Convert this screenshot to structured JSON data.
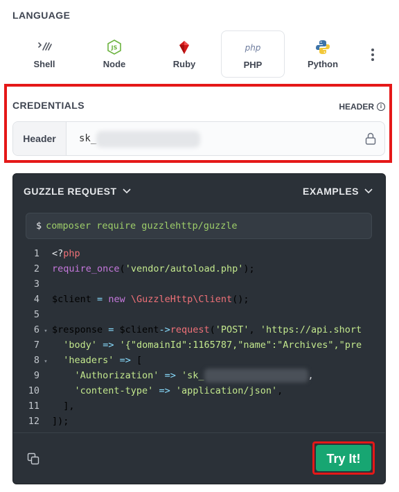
{
  "language": {
    "label": "LANGUAGE",
    "items": [
      {
        "label": "Shell",
        "icon": "shell-icon"
      },
      {
        "label": "Node",
        "icon": "node-icon"
      },
      {
        "label": "Ruby",
        "icon": "ruby-icon"
      },
      {
        "label": "PHP",
        "icon": "php-icon",
        "active": true
      },
      {
        "label": "Python",
        "icon": "python-icon"
      }
    ],
    "php_logo_text": "php"
  },
  "credentials": {
    "label": "CREDENTIALS",
    "location_label": "HEADER",
    "key_label": "Header",
    "value_prefix": "sk_"
  },
  "panel": {
    "request_label": "GUZZLE REQUEST",
    "examples_label": "EXAMPLES",
    "command": "composer require guzzlehttp/guzzle",
    "code_lines": [
      {
        "n": "1",
        "text": "<?php"
      },
      {
        "n": "2",
        "text": "require_once('vendor/autoload.php');"
      },
      {
        "n": "3",
        "text": ""
      },
      {
        "n": "4",
        "text": "$client = new \\GuzzleHttp\\Client();"
      },
      {
        "n": "5",
        "text": ""
      },
      {
        "n": "6",
        "text": "$response = $client->request('POST', 'https://api.short"
      },
      {
        "n": "7",
        "text": "  'body' => '{\"domainId\":1165787,\"name\":\"Archives\",\"pre"
      },
      {
        "n": "8",
        "text": "  'headers' => ["
      },
      {
        "n": "9",
        "text": "    'Authorization' => 'sk_"
      },
      {
        "n": "10",
        "text": "    'content-type' => 'application/json',"
      },
      {
        "n": "11",
        "text": "  ],"
      },
      {
        "n": "12",
        "text": "]);"
      }
    ],
    "try_label": "Try It!"
  },
  "colors": {
    "accent": "#17a672",
    "highlight": "#e51818",
    "panel_bg": "#2b3138"
  }
}
